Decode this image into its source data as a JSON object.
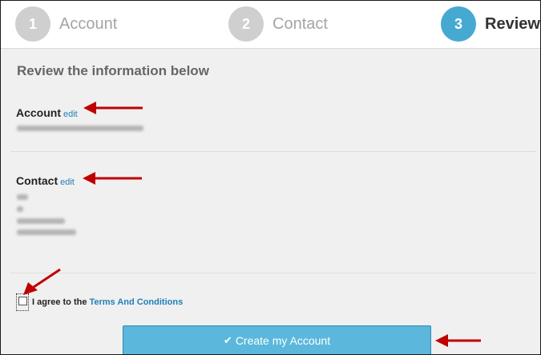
{
  "steps": [
    {
      "number": "1",
      "label": "Account",
      "active": false
    },
    {
      "number": "2",
      "label": "Contact",
      "active": false
    },
    {
      "number": "3",
      "label": "Review",
      "active": true
    }
  ],
  "heading": "Review the information below",
  "account": {
    "title": "Account",
    "edit_label": "edit"
  },
  "contact": {
    "title": "Contact",
    "edit_label": "edit"
  },
  "agree": {
    "text": "I agree to the",
    "terms_link": "Terms And Conditions",
    "checked": false
  },
  "create_button": {
    "label": "Create my Account",
    "icon": "check-icon"
  },
  "colors": {
    "accent": "#46a9d2",
    "button": "#5bb8dc",
    "link": "#1f7fb6",
    "annotation_arrow": "#c00000"
  }
}
